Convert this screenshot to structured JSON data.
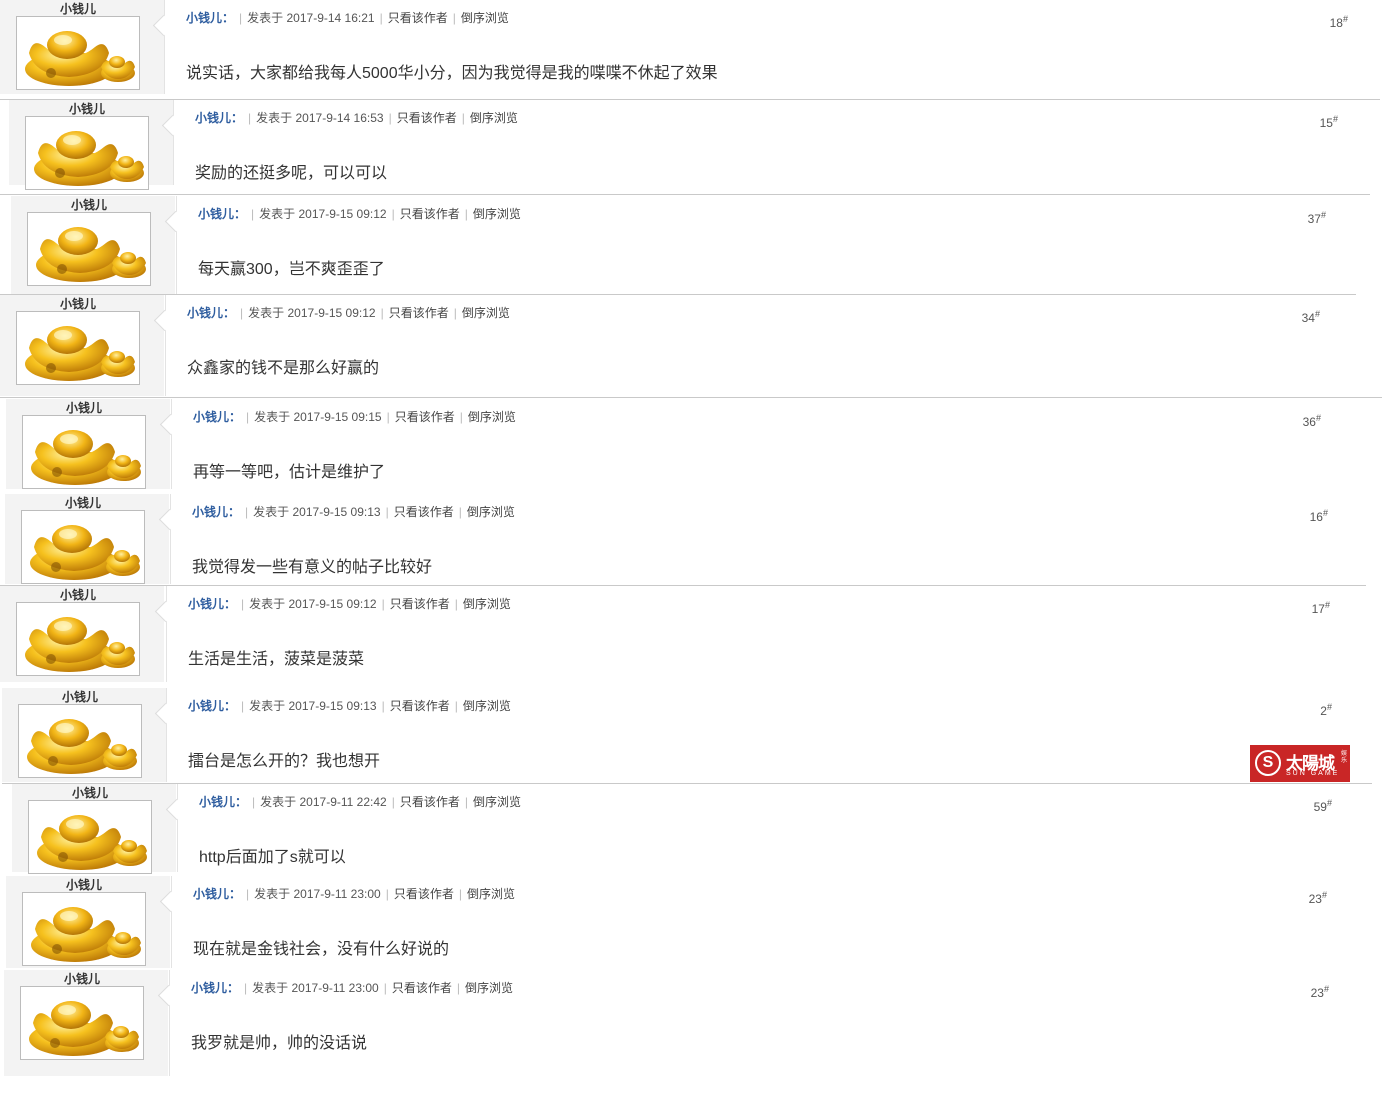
{
  "posts": [
    {
      "username": "小钱儿",
      "author": "小钱儿：",
      "posted_label": "发表于",
      "date": "2017-9-14 16:21",
      "only_author": "只看该作者",
      "reverse_view": "倒序浏览",
      "floor": "18",
      "floor_mark": "#",
      "content": "说实话，大家都给我每人5000华小分，因为我觉得是我的喋喋不休起了效果"
    },
    {
      "username": "小钱儿",
      "author": "小钱儿：",
      "posted_label": "发表于",
      "date": "2017-9-14 16:53",
      "only_author": "只看该作者",
      "reverse_view": "倒序浏览",
      "floor": "15",
      "floor_mark": "#",
      "content": "奖励的还挺多呢，可以可以"
    },
    {
      "username": "小钱儿",
      "author": "小钱儿：",
      "posted_label": "发表于",
      "date": "2017-9-15 09:12",
      "only_author": "只看该作者",
      "reverse_view": "倒序浏览",
      "floor": "37",
      "floor_mark": "#",
      "content": "每天赢300，岂不爽歪歪了"
    },
    {
      "username": "小钱儿",
      "author": "小钱儿：",
      "posted_label": "发表于",
      "date": "2017-9-15 09:12",
      "only_author": "只看该作者",
      "reverse_view": "倒序浏览",
      "floor": "34",
      "floor_mark": "#",
      "content": "众鑫家的钱不是那么好赢的"
    },
    {
      "username": "小钱儿",
      "author": "小钱儿：",
      "posted_label": "发表于",
      "date": "2017-9-15 09:15",
      "only_author": "只看该作者",
      "reverse_view": "倒序浏览",
      "floor": "36",
      "floor_mark": "#",
      "content": "再等一等吧，估计是维护了"
    },
    {
      "username": "小钱儿",
      "author": "小钱儿：",
      "posted_label": "发表于",
      "date": "2017-9-15 09:13",
      "only_author": "只看该作者",
      "reverse_view": "倒序浏览",
      "floor": "16",
      "floor_mark": "#",
      "content": "我觉得发一些有意义的帖子比较好"
    },
    {
      "username": "小钱儿",
      "author": "小钱儿：",
      "posted_label": "发表于",
      "date": "2017-9-15 09:12",
      "only_author": "只看该作者",
      "reverse_view": "倒序浏览",
      "floor": "17",
      "floor_mark": "#",
      "content": "生活是生活，菠菜是菠菜"
    },
    {
      "username": "小钱儿",
      "author": "小钱儿：",
      "posted_label": "发表于",
      "date": "2017-9-15 09:13",
      "only_author": "只看该作者",
      "reverse_view": "倒序浏览",
      "floor": "2",
      "floor_mark": "#",
      "content": "擂台是怎么开的？我也想开"
    },
    {
      "username": "小钱儿",
      "author": "小钱儿：",
      "posted_label": "发表于",
      "date": "2017-9-11 22:42",
      "only_author": "只看该作者",
      "reverse_view": "倒序浏览",
      "floor": "59",
      "floor_mark": "#",
      "content": "http后面加了s就可以"
    },
    {
      "username": "小钱儿",
      "author": "小钱儿：",
      "posted_label": "发表于",
      "date": "2017-9-11 23:00",
      "only_author": "只看该作者",
      "reverse_view": "倒序浏览",
      "floor": "23",
      "floor_mark": "#",
      "content": "现在就是金钱社会，没有什么好说的"
    },
    {
      "username": "小钱儿",
      "author": "小钱儿：",
      "posted_label": "发表于",
      "date": "2017-9-11 23:00",
      "only_author": "只看该作者",
      "reverse_view": "倒序浏览",
      "floor": "23",
      "floor_mark": "#",
      "content": "我罗就是帅，帅的没话说"
    }
  ],
  "ad": {
    "logo_letter": "S",
    "cn_text": "太陽城",
    "en_text": "SUN GAME",
    "sub_text": "娱乐"
  },
  "colors": {
    "author": "#2e5d9f",
    "sidebar": "#f3f3f3",
    "ad_red": "#c92626",
    "ingot_gold": "#f2b516"
  },
  "icons": {
    "avatar": "gold-ingot-icon"
  }
}
